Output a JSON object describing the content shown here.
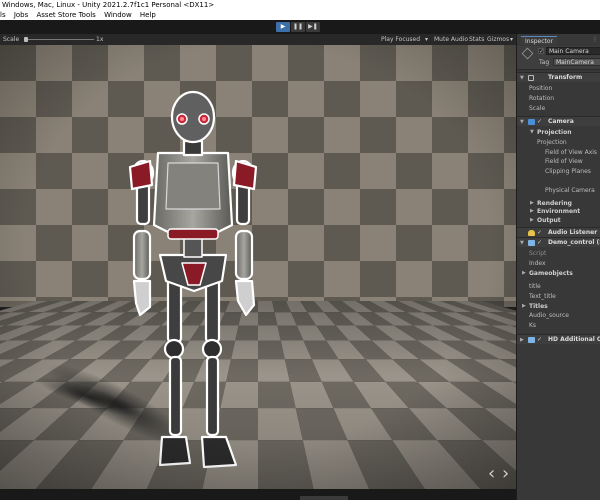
{
  "window": {
    "title": "Windows, Mac, Linux - Unity 2021.2.7f1c1 Personal <DX11>"
  },
  "menu": {
    "items": [
      "ls",
      "Jobs",
      "Asset Store Tools",
      "Window",
      "Help"
    ]
  },
  "play_controls": {
    "play_icon": "▶",
    "pause_icon": "❚❚",
    "step_icon": "▶❚"
  },
  "game_toolbar": {
    "scale_label": "Scale",
    "scale_value": "1x",
    "play_mode": "Play Focused",
    "play_mode_arrow": "▾",
    "mute_audio": "Mute Audio",
    "stats": "Stats",
    "gizmos": "Gizmos",
    "gizmos_arrow": "▾"
  },
  "inspector": {
    "tab_label": "Inspector",
    "tab_menu": "⋮",
    "object_name": "Main Camera",
    "object_active_check": "✓",
    "tag_label": "Tag",
    "tag_value": "MainCamera",
    "components": {
      "transform": {
        "name": "Transform",
        "arrow": "▼",
        "fields": [
          "Position",
          "Rotation",
          "Scale"
        ]
      },
      "camera": {
        "name": "Camera",
        "arrow": "▼",
        "check": "✓",
        "projection_header": "Projection",
        "projection_arrow": "▼",
        "fields": [
          "Projection",
          "Field of View Axis",
          "Field of View",
          "Clipping Planes",
          "Physical Camera"
        ],
        "rendering": "Rendering",
        "environment": "Environment",
        "output": "Output",
        "section_arrow": "▶"
      },
      "audio_listener": {
        "name": "Audio Listener",
        "check": "✓"
      },
      "demo_control": {
        "name": "Demo_control (Scri",
        "arrow": "▼",
        "check": "✓",
        "fields": [
          "Script",
          "Index"
        ],
        "gameobjects": "Gameobjects",
        "gameobjects_arrow": "▶",
        "title_label": "title",
        "text_title": "Text_title",
        "titles": "Titles",
        "titles_arrow": "▶",
        "audio_source": "Audio_source",
        "ks": "Ks"
      },
      "hd_camera": {
        "name": "HD Additional Cam",
        "arrow": "▶",
        "check": "✓"
      }
    }
  },
  "scene": {
    "nav_left": "‹",
    "nav_right": "›"
  },
  "colors": {
    "play_active": "#3d6fa8",
    "robot_eye": "#c8283a",
    "outline": "#ffffff",
    "camera_icon": "#4a90d9",
    "audio_icon": "#e6c24a",
    "script_icon": "#7fb5e6"
  }
}
